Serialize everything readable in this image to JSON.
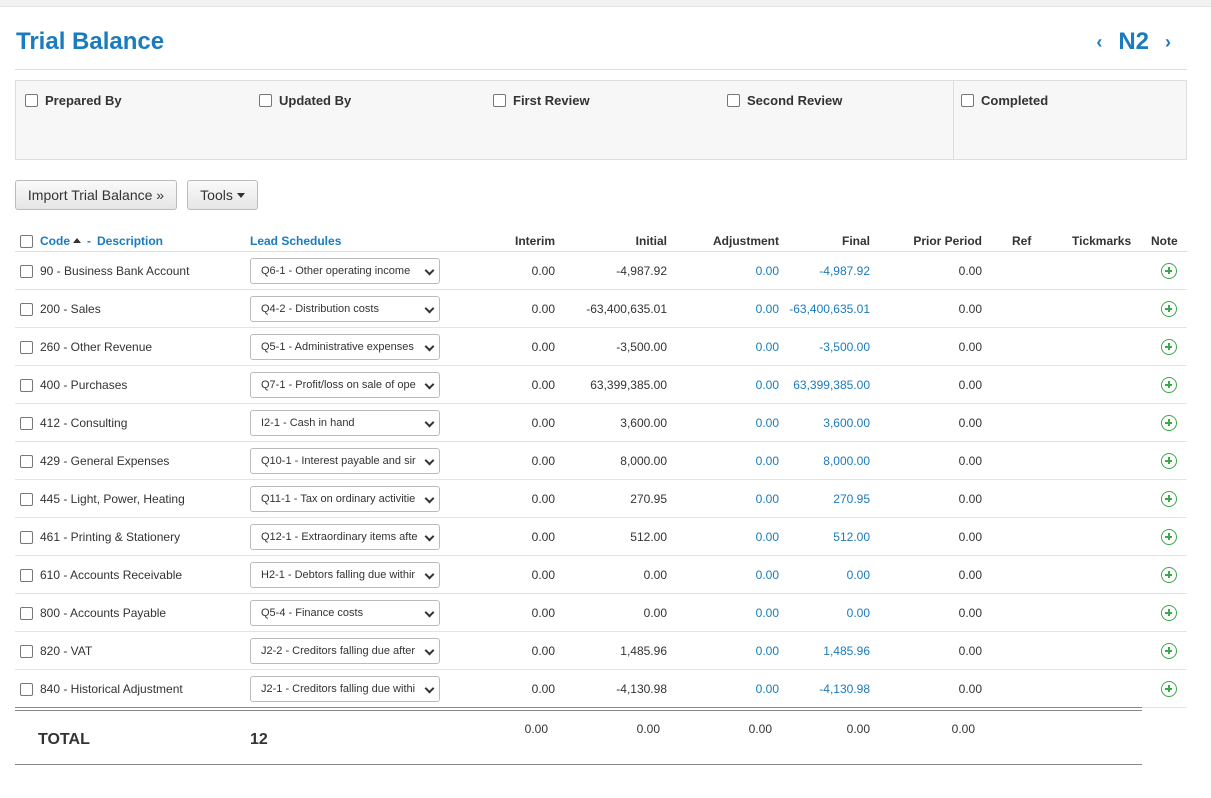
{
  "header": {
    "title": "Trial Balance",
    "code": "N2",
    "prev_icon": "chevron-left-icon",
    "next_icon": "chevron-right-icon"
  },
  "signoff": [
    {
      "label": "Prepared By",
      "checked": false
    },
    {
      "label": "Updated By",
      "checked": false
    },
    {
      "label": "First Review",
      "checked": false
    },
    {
      "label": "Second Review",
      "checked": false
    },
    {
      "label": "Completed",
      "checked": false
    }
  ],
  "toolbar": {
    "import_label": "Import Trial Balance »",
    "tools_label": "Tools"
  },
  "columns": {
    "code": "Code",
    "dash": "-",
    "description": "Description",
    "lead": "Lead Schedules",
    "interim": "Interim",
    "initial": "Initial",
    "adjustment": "Adjustment",
    "final": "Final",
    "prior": "Prior Period",
    "ref": "Ref",
    "tickmarks": "Tickmarks",
    "note": "Note"
  },
  "rows": [
    {
      "account": "90 - Business Bank Account",
      "lead": "Q6-1 - Other operating income",
      "interim": "0.00",
      "initial": "-4,987.92",
      "adjustment": "0.00",
      "final": "-4,987.92",
      "prior": "0.00"
    },
    {
      "account": "200 - Sales",
      "lead": "Q4-2 - Distribution costs",
      "interim": "0.00",
      "initial": "-63,400,635.01",
      "adjustment": "0.00",
      "final": "-63,400,635.01",
      "prior": "0.00"
    },
    {
      "account": "260 - Other Revenue",
      "lead": "Q5-1 - Administrative expenses",
      "interim": "0.00",
      "initial": "-3,500.00",
      "adjustment": "0.00",
      "final": "-3,500.00",
      "prior": "0.00"
    },
    {
      "account": "400 - Purchases",
      "lead": "Q7-1 - Profit/loss on sale of ope",
      "interim": "0.00",
      "initial": "63,399,385.00",
      "adjustment": "0.00",
      "final": "63,399,385.00",
      "prior": "0.00"
    },
    {
      "account": "412 - Consulting",
      "lead": "I2-1 - Cash in hand",
      "interim": "0.00",
      "initial": "3,600.00",
      "adjustment": "0.00",
      "final": "3,600.00",
      "prior": "0.00"
    },
    {
      "account": "429 - General Expenses",
      "lead": "Q10-1 - Interest payable and sir",
      "interim": "0.00",
      "initial": "8,000.00",
      "adjustment": "0.00",
      "final": "8,000.00",
      "prior": "0.00"
    },
    {
      "account": "445 - Light, Power, Heating",
      "lead": "Q11-1 - Tax on ordinary activitie",
      "interim": "0.00",
      "initial": "270.95",
      "adjustment": "0.00",
      "final": "270.95",
      "prior": "0.00"
    },
    {
      "account": "461 - Printing & Stationery",
      "lead": "Q12-1 - Extraordinary items afte",
      "interim": "0.00",
      "initial": "512.00",
      "adjustment": "0.00",
      "final": "512.00",
      "prior": "0.00"
    },
    {
      "account": "610 - Accounts Receivable",
      "lead": "H2-1 - Debtors falling due withir",
      "interim": "0.00",
      "initial": "0.00",
      "adjustment": "0.00",
      "final": "0.00",
      "prior": "0.00"
    },
    {
      "account": "800 - Accounts Payable",
      "lead": "Q5-4 - Finance costs",
      "interim": "0.00",
      "initial": "0.00",
      "adjustment": "0.00",
      "final": "0.00",
      "prior": "0.00"
    },
    {
      "account": "820 - VAT",
      "lead": "J2-2 - Creditors falling due after",
      "interim": "0.00",
      "initial": "1,485.96",
      "adjustment": "0.00",
      "final": "1,485.96",
      "prior": "0.00"
    },
    {
      "account": "840 - Historical Adjustment",
      "lead": "J2-1 - Creditors falling due withi",
      "interim": "0.00",
      "initial": "-4,130.98",
      "adjustment": "0.00",
      "final": "-4,130.98",
      "prior": "0.00"
    }
  ],
  "totals": {
    "label": "TOTAL",
    "count": "12",
    "interim": "0.00",
    "initial": "0.00",
    "adjustment": "0.00",
    "final": "0.00",
    "prior": "0.00"
  },
  "colors": {
    "accent": "#1a7bbf",
    "add": "#3aa84b"
  }
}
